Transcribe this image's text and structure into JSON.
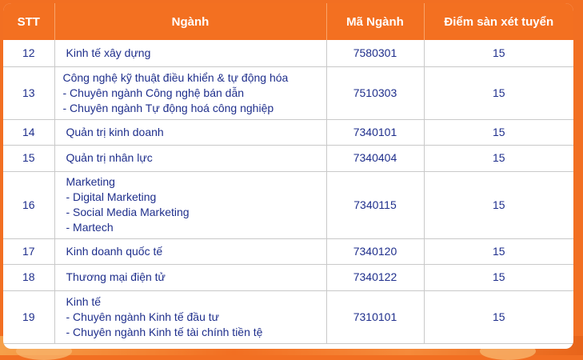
{
  "headers": {
    "stt": "STT",
    "nganh": "Ngành",
    "ma_nganh": "Mã Ngành",
    "diem": "Điểm sàn xét tuyển"
  },
  "rows": [
    {
      "stt": "12",
      "lines": [
        "Kinh tế xây dựng"
      ],
      "ma": "7580301",
      "diem": "15"
    },
    {
      "stt": "13",
      "lines": [
        "Công nghệ kỹ thuật điều khiển & tự động hóa",
        "- Chuyên ngành Công nghệ bán dẫn",
        "- Chuyên ngành Tự động hoá công nghiệp"
      ],
      "ma": "7510303",
      "diem": "15"
    },
    {
      "stt": "14",
      "lines": [
        "Quản trị kinh doanh"
      ],
      "ma": "7340101",
      "diem": "15"
    },
    {
      "stt": "15",
      "lines": [
        "Quản trị nhân lực"
      ],
      "ma": "7340404",
      "diem": "15"
    },
    {
      "stt": "16",
      "lines": [
        "Marketing",
        "- Digital Marketing",
        "- Social Media Marketing",
        "- Martech"
      ],
      "ma": "7340115",
      "diem": "15"
    },
    {
      "stt": "17",
      "lines": [
        "Kinh doanh quốc tế"
      ],
      "ma": "7340120",
      "diem": "15"
    },
    {
      "stt": "18",
      "lines": [
        "Thương mại điện tử"
      ],
      "ma": "7340122",
      "diem": "15"
    },
    {
      "stt": "19",
      "lines": [
        "Kinh tế",
        "- Chuyên ngành Kinh tế đầu tư",
        "- Chuyên ngành Kinh tế tài chính tiền tệ"
      ],
      "ma": "7310101",
      "diem": "15"
    }
  ]
}
